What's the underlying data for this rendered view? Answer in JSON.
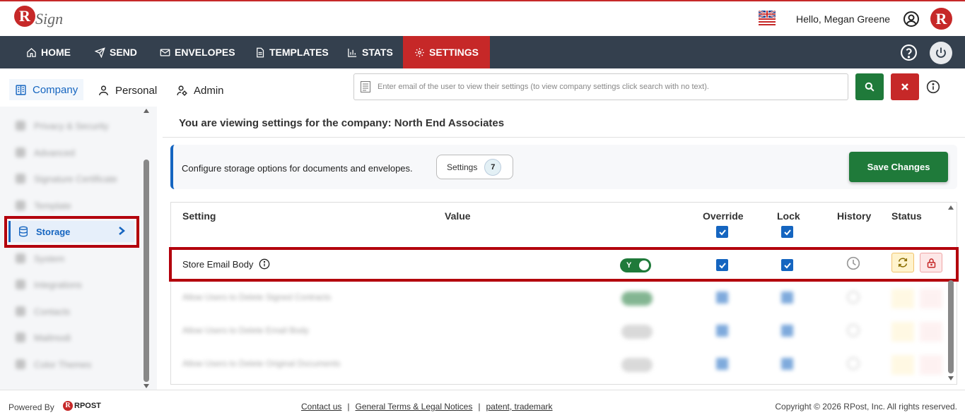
{
  "app": {
    "logo_text": "Sign",
    "logo_letter": "R",
    "greeting": "Hello, Megan Greene",
    "brand_letter": "R"
  },
  "nav": {
    "items": [
      {
        "label": "HOME",
        "icon": "home-icon"
      },
      {
        "label": "SEND",
        "icon": "send-icon"
      },
      {
        "label": "ENVELOPES",
        "icon": "envelope-icon"
      },
      {
        "label": "TEMPLATES",
        "icon": "template-icon"
      },
      {
        "label": "STATS",
        "icon": "stats-icon"
      },
      {
        "label": "SETTINGS",
        "icon": "gear-icon",
        "active": true
      }
    ]
  },
  "subtabs": {
    "company": "Company",
    "personal": "Personal",
    "admin": "Admin"
  },
  "search": {
    "placeholder": "Enter email of the user to view their settings (to view company settings click search with no text)."
  },
  "sidebar": {
    "items": [
      "Privacy & Security",
      "Advanced",
      "Signature Certificate",
      "Template",
      "Storage",
      "System",
      "Integrations",
      "Contacts",
      "Mailmodi",
      "Color Themes"
    ],
    "selected": "Storage"
  },
  "main": {
    "viewing_text": "You are viewing settings for the company: North End Associates",
    "config_text": "Configure storage options for documents and envelopes.",
    "settings_chip_label": "Settings",
    "settings_count": "7",
    "save_label": "Save Changes"
  },
  "table": {
    "headers": {
      "setting": "Setting",
      "value": "Value",
      "override": "Override",
      "lock": "Lock",
      "history": "History",
      "status": "Status"
    },
    "rows": [
      {
        "label": "Store Email Body",
        "toggle": "Y",
        "toggle_on": true,
        "override": true,
        "lock": true
      },
      {
        "label": "Allow Users to Delete Signed Contracts",
        "toggle_on": true
      },
      {
        "label": "Allow Users to Delete Email Body",
        "toggle_on": false
      },
      {
        "label": "Allow Users to Delete Original Documents",
        "toggle_on": false
      }
    ]
  },
  "footer": {
    "powered_by": "Powered By",
    "rpost": "RPOST",
    "links": [
      "Contact us",
      "General Terms & Legal Notices",
      "patent, trademark"
    ],
    "copyright": "Copyright © 2026 RPost, Inc. All rights reserved."
  },
  "colors": {
    "nav_bg": "#34404e",
    "accent_red": "#c62828",
    "accent_blue": "#1565c0",
    "save_green": "#1f7a3a"
  }
}
